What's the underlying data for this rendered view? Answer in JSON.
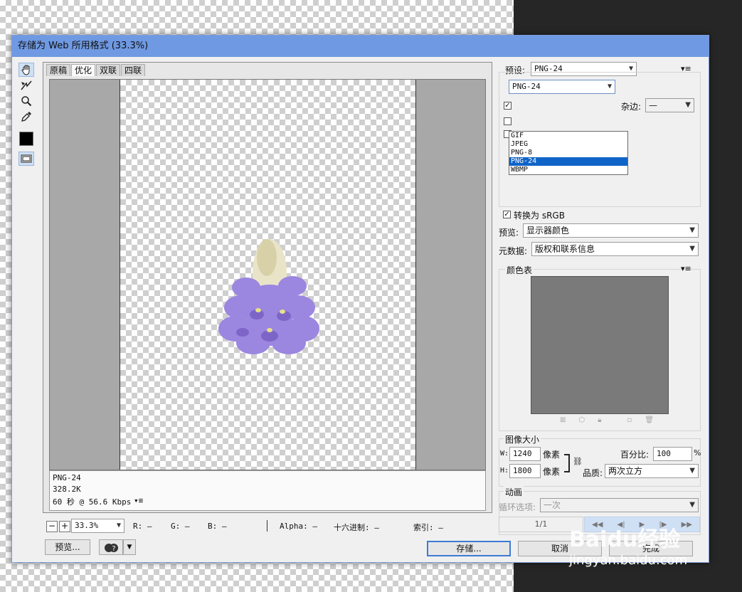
{
  "window": {
    "title": "存储为 Web 所用格式 (33.3%)"
  },
  "tabs": [
    "原稿",
    "优化",
    "双联",
    "四联"
  ],
  "tools": [
    "hand-icon",
    "slice-select-icon",
    "zoom-icon",
    "eyedropper-icon",
    "color-swatch-icon",
    "toggle-slices-icon"
  ],
  "image_info": {
    "format": "PNG-24",
    "size": "328.2K",
    "speed": "60 秒 @ 56.6 Kbps",
    "menu": "▾≡"
  },
  "status": {
    "zoom": "33.3%",
    "r": "R: —",
    "g": "G: —",
    "b": "B: —",
    "alpha": "Alpha: —",
    "hex": "十六进制: —",
    "index": "索引: —"
  },
  "buttons": {
    "preview": "预览...",
    "help": "?",
    "save": "存储...",
    "cancel": "取消",
    "done": "完成"
  },
  "settings": {
    "preset_label": "预设:",
    "preset_value": "PNG-24",
    "menu": "▾≡",
    "format_value": "PNG-24",
    "format_options": [
      "GIF",
      "JPEG",
      "PNG-8",
      "PNG-24",
      "WBMP"
    ],
    "format_selected": "PNG-24",
    "matte_label": "杂边:",
    "matte_value": "—"
  },
  "color": {
    "convert_srgb": "转换为 sRGB",
    "preview_label": "预览:",
    "preview_value": "显示器颜色",
    "metadata_label": "元数据:",
    "metadata_value": "版权和联系信息"
  },
  "color_table": {
    "title": "颜色表",
    "menu": "▾≡"
  },
  "image_size": {
    "title": "图像大小",
    "w_label": "W:",
    "w_value": "1240",
    "h_label": "H:",
    "h_value": "1800",
    "unit": "像素",
    "percent_label": "百分比:",
    "percent_value": "100",
    "percent_unit": "%",
    "quality_label": "品质:",
    "quality_value": "两次立方"
  },
  "animation": {
    "title": "动画",
    "loop_label": "循环选项:",
    "loop_value": "一次",
    "frame": "1/1"
  },
  "watermark": {
    "logo": "Baidu经验",
    "url": "jingyan.baidu.com"
  }
}
